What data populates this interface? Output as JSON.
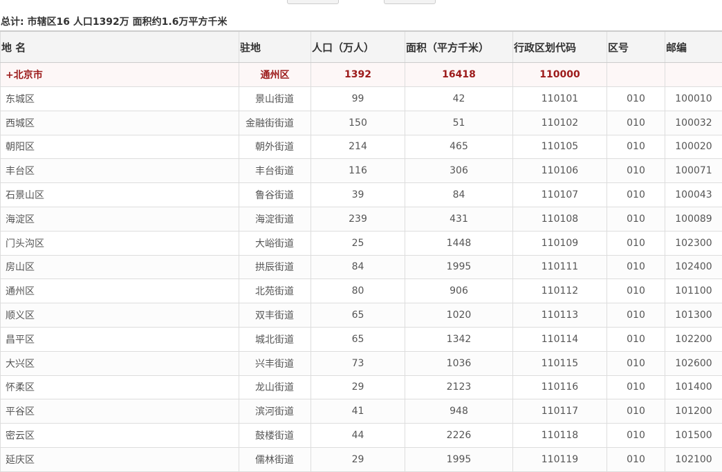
{
  "summary": "总计: 市辖区16 人口1392万 面积约1.6万平方千米",
  "headers": {
    "name": "地 名",
    "seat": "驻地",
    "population": "人口（万人）",
    "area": "面积（平方千米）",
    "code": "行政区划代码",
    "area_code": "区号",
    "postcode": "邮编"
  },
  "city": {
    "name": "+北京市",
    "seat": "通州区",
    "population": "1392",
    "area": "16418",
    "code": "110000",
    "area_code": "",
    "postcode": ""
  },
  "rows": [
    {
      "name": "东城区",
      "seat": "景山街道",
      "population": "99",
      "area": "42",
      "code": "110101",
      "area_code": "010",
      "postcode": "100010"
    },
    {
      "name": "西城区",
      "seat": "金融街街道",
      "population": "150",
      "area": "51",
      "code": "110102",
      "area_code": "010",
      "postcode": "100032"
    },
    {
      "name": "朝阳区",
      "seat": "朝外街道",
      "population": "214",
      "area": "465",
      "code": "110105",
      "area_code": "010",
      "postcode": "100020"
    },
    {
      "name": "丰台区",
      "seat": "丰台街道",
      "population": "116",
      "area": "306",
      "code": "110106",
      "area_code": "010",
      "postcode": "100071"
    },
    {
      "name": "石景山区",
      "seat": "鲁谷街道",
      "population": "39",
      "area": "84",
      "code": "110107",
      "area_code": "010",
      "postcode": "100043"
    },
    {
      "name": "海淀区",
      "seat": "海淀街道",
      "population": "239",
      "area": "431",
      "code": "110108",
      "area_code": "010",
      "postcode": "100089"
    },
    {
      "name": "门头沟区",
      "seat": "大峪街道",
      "population": "25",
      "area": "1448",
      "code": "110109",
      "area_code": "010",
      "postcode": "102300"
    },
    {
      "name": "房山区",
      "seat": "拱辰街道",
      "population": "84",
      "area": "1995",
      "code": "110111",
      "area_code": "010",
      "postcode": "102400"
    },
    {
      "name": "通州区",
      "seat": "北苑街道",
      "population": "80",
      "area": "906",
      "code": "110112",
      "area_code": "010",
      "postcode": "101100"
    },
    {
      "name": "顺义区",
      "seat": "双丰街道",
      "population": "65",
      "area": "1020",
      "code": "110113",
      "area_code": "010",
      "postcode": "101300"
    },
    {
      "name": "昌平区",
      "seat": "城北街道",
      "population": "65",
      "area": "1342",
      "code": "110114",
      "area_code": "010",
      "postcode": "102200"
    },
    {
      "name": "大兴区",
      "seat": "兴丰街道",
      "population": "73",
      "area": "1036",
      "code": "110115",
      "area_code": "010",
      "postcode": "102600"
    },
    {
      "name": "怀柔区",
      "seat": "龙山街道",
      "population": "29",
      "area": "2123",
      "code": "110116",
      "area_code": "010",
      "postcode": "101400"
    },
    {
      "name": "平谷区",
      "seat": "滨河街道",
      "population": "41",
      "area": "948",
      "code": "110117",
      "area_code": "010",
      "postcode": "101200"
    },
    {
      "name": "密云区",
      "seat": "鼓楼街道",
      "population": "44",
      "area": "2226",
      "code": "110118",
      "area_code": "010",
      "postcode": "101500"
    },
    {
      "name": "延庆区",
      "seat": "儒林街道",
      "population": "29",
      "area": "1995",
      "code": "110119",
      "area_code": "010",
      "postcode": "102100"
    }
  ]
}
